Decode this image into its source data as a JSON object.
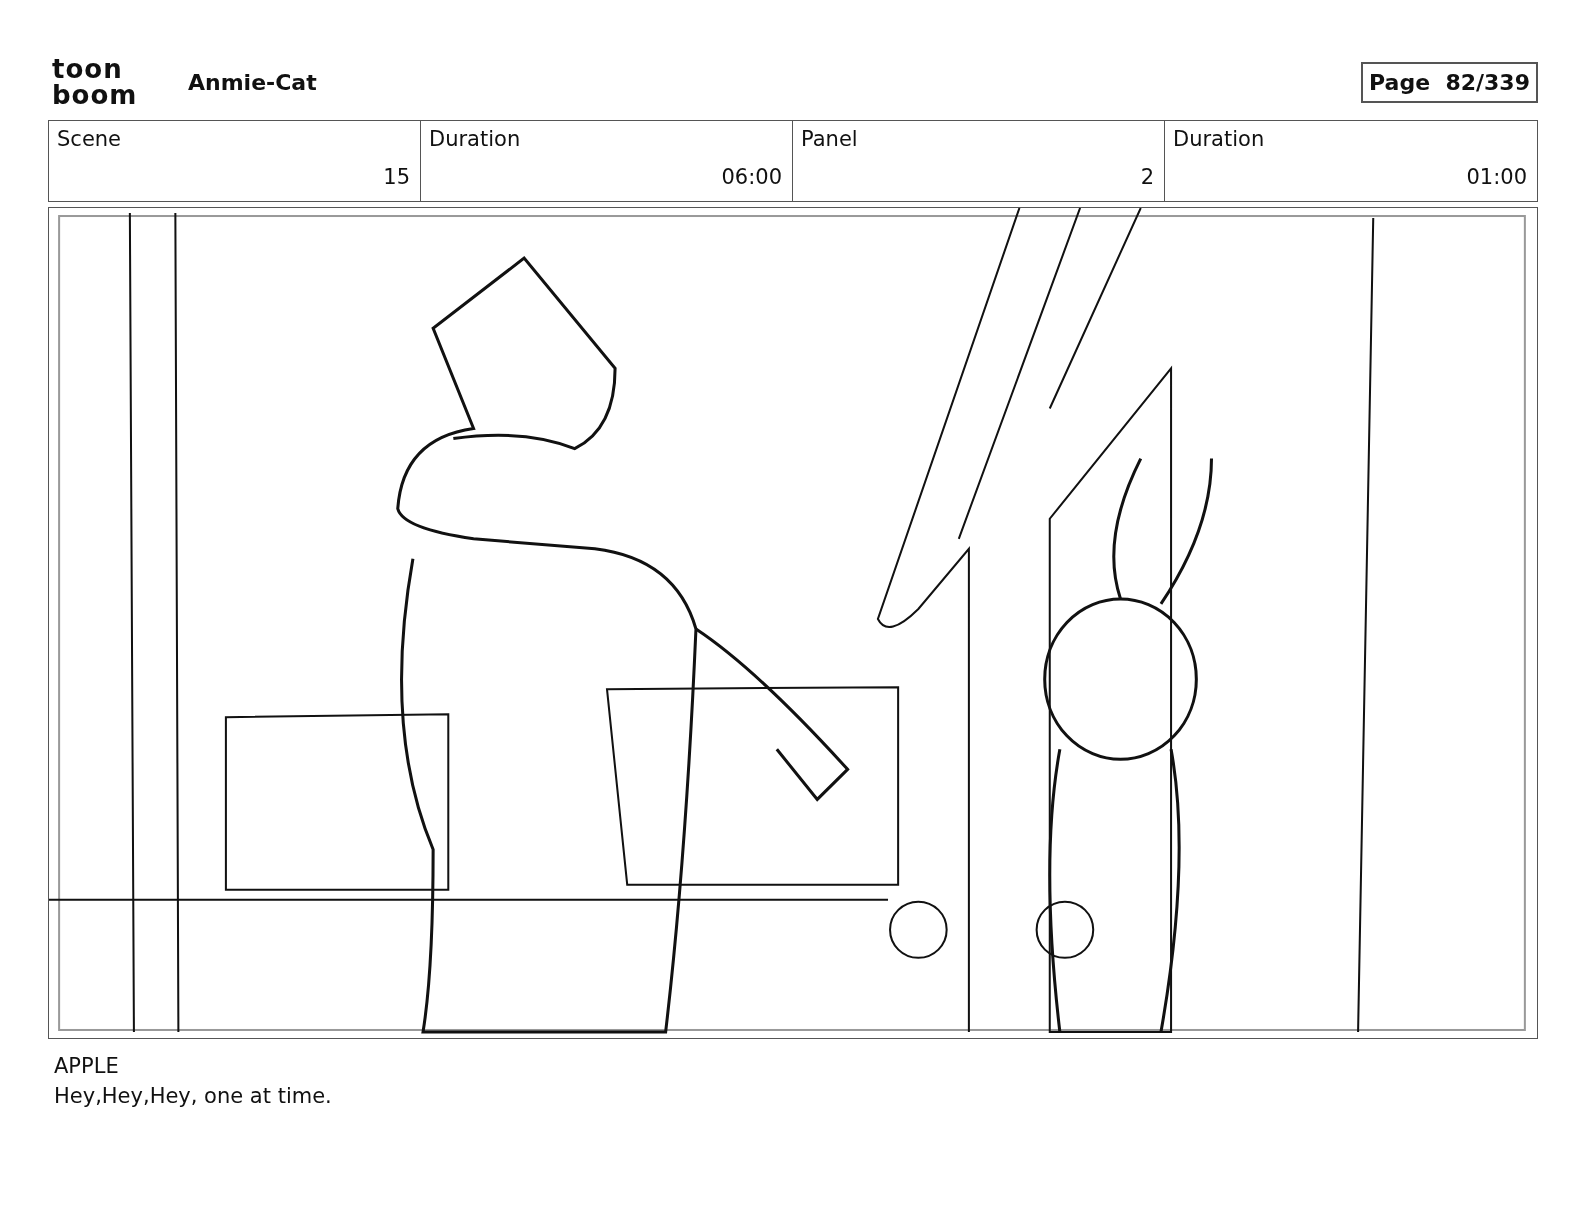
{
  "header": {
    "logo_top": "toon",
    "logo_bottom": "boom",
    "project": "Anmie-Cat",
    "page": "Page  82/339"
  },
  "fields": [
    {
      "label": "Scene",
      "value": "15"
    },
    {
      "label": "Duration",
      "value": "06:00"
    },
    {
      "label": "Panel",
      "value": "2"
    },
    {
      "label": "Duration",
      "value": "01:00"
    }
  ],
  "dialogue": {
    "character": "APPLE",
    "line": "Hey,Hey,Hey, one at time."
  }
}
